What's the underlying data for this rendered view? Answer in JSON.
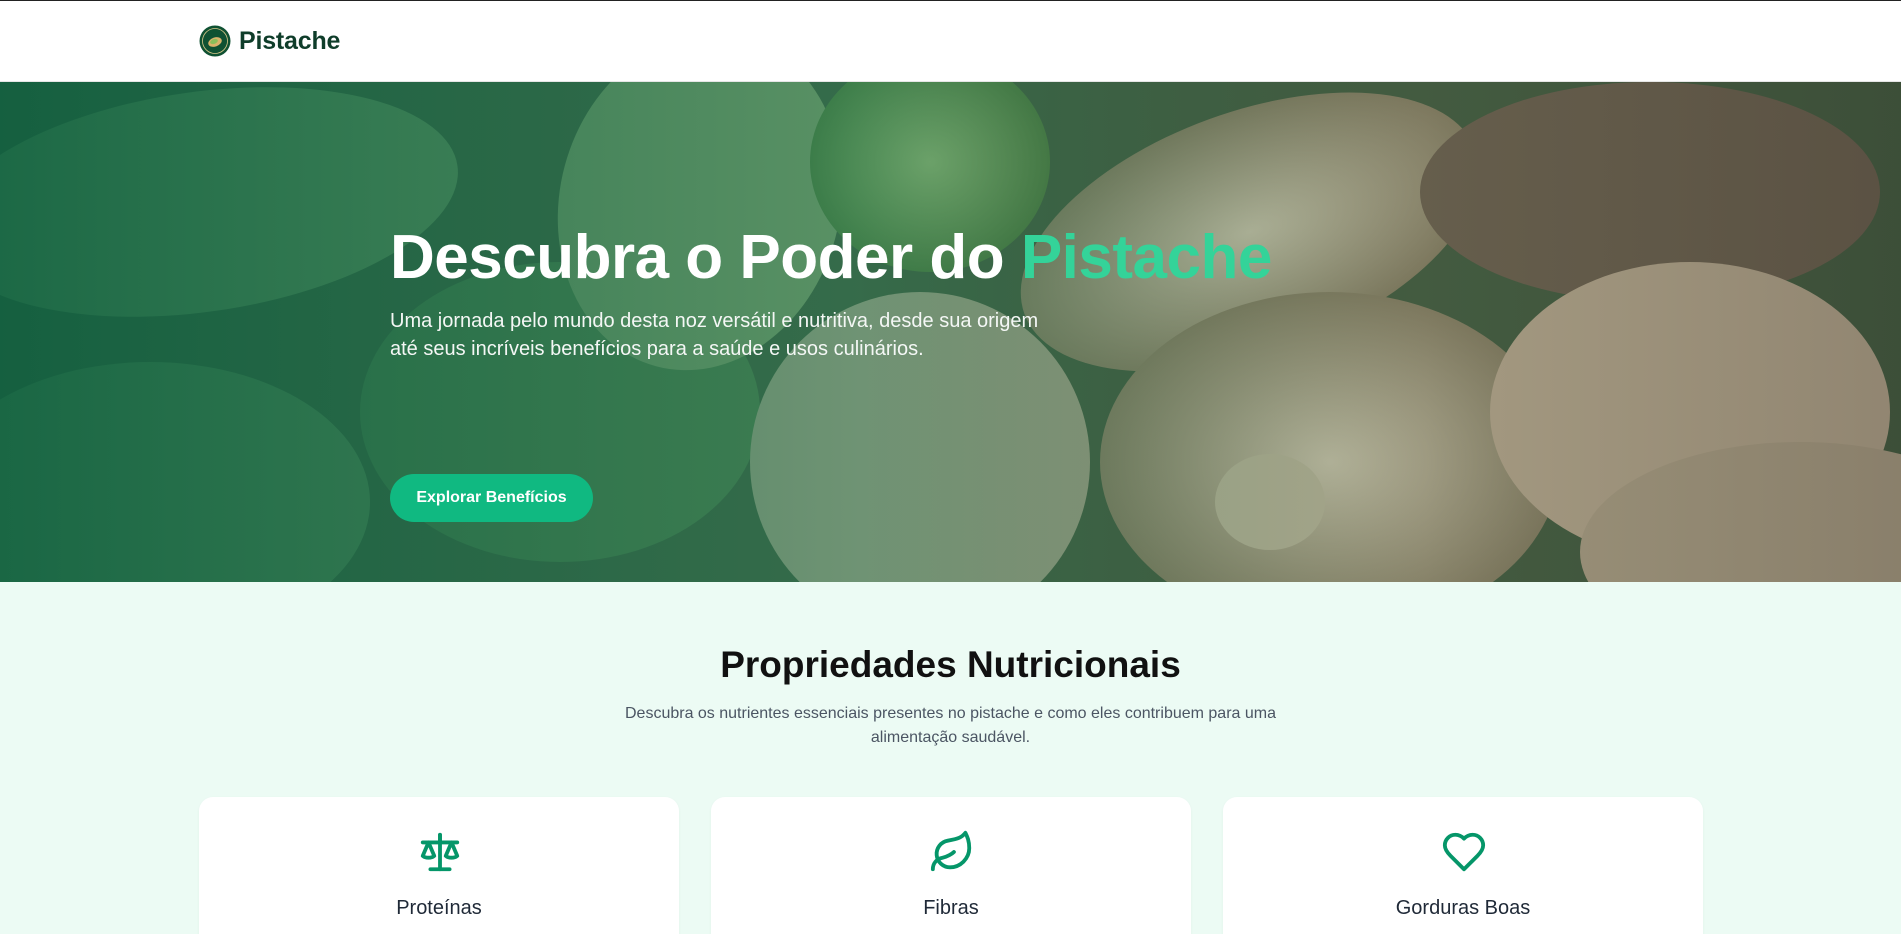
{
  "nav": {
    "brand_name": "Pistache"
  },
  "hero": {
    "title_main": "Descubra o Poder do ",
    "title_accent": "Pistache",
    "subtitle": "Uma jornada pelo mundo desta noz versátil e nutritiva, desde sua origem até seus incríveis benefícios para a saúde e usos culinários.",
    "button_label": "Explorar Benefícios"
  },
  "nutrition": {
    "title": "Propriedades Nutricionais",
    "subtitle": "Descubra os nutrientes essenciais presentes no pistache e como eles contribuem para uma alimentação saudável.",
    "cards": [
      {
        "icon": "scale-icon",
        "title": "Proteínas"
      },
      {
        "icon": "leaf-icon",
        "title": "Fibras"
      },
      {
        "icon": "heart-icon",
        "title": "Gorduras Boas"
      }
    ]
  },
  "colors": {
    "accent": "#34d399",
    "button": "#10b981",
    "icon": "#059669",
    "brand_text": "#0f3d2a",
    "section_bg": "#ecfbf4"
  }
}
